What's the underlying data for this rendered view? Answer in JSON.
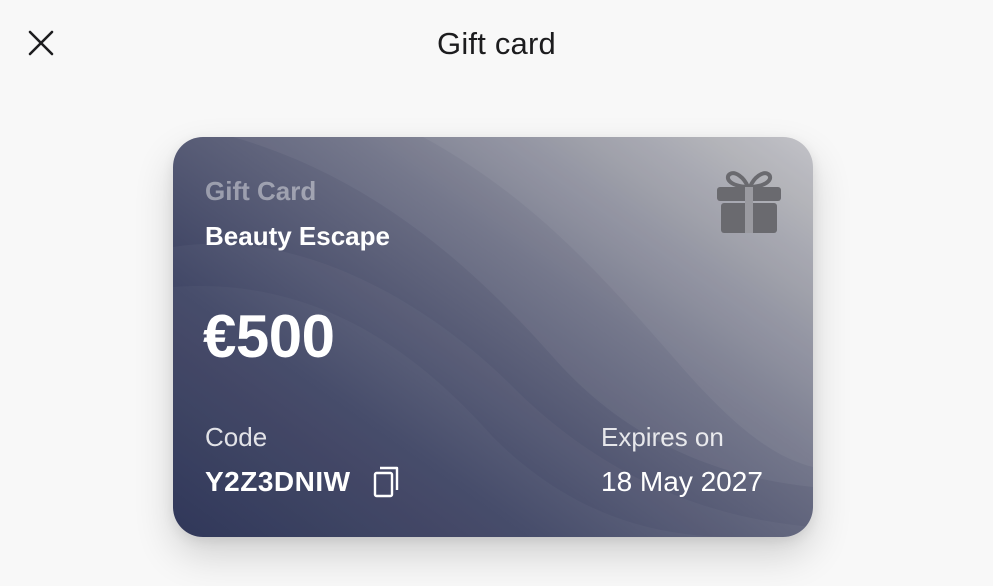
{
  "header": {
    "title": "Gift card",
    "close_icon": "close-icon"
  },
  "card": {
    "label": "Gift Card",
    "name": "Beauty Escape",
    "amount": "€500",
    "icon": "gift-icon",
    "code_label": "Code",
    "code": "Y2Z3DNIW",
    "copy_icon": "copy-icon",
    "expires_label": "Expires on",
    "expires_value": "18 May 2027",
    "colors": {
      "gradient_dark": "#232a4e",
      "gradient_light": "#bdbdc2",
      "text": "#ffffff"
    }
  }
}
